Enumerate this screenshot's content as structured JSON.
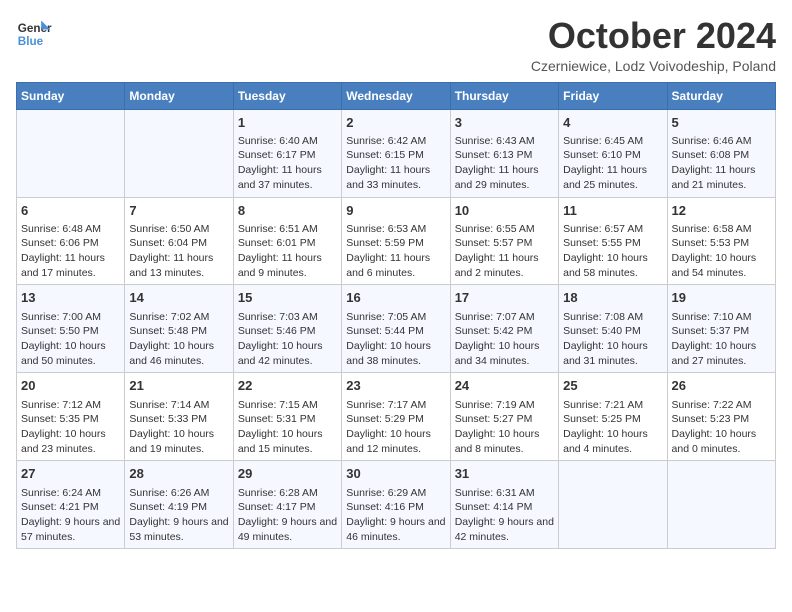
{
  "header": {
    "logo_line1": "General",
    "logo_line2": "Blue",
    "month_title": "October 2024",
    "location": "Czerniewice, Lodz Voivodeship, Poland"
  },
  "days_of_week": [
    "Sunday",
    "Monday",
    "Tuesday",
    "Wednesday",
    "Thursday",
    "Friday",
    "Saturday"
  ],
  "weeks": [
    [
      {
        "day": "",
        "info": ""
      },
      {
        "day": "",
        "info": ""
      },
      {
        "day": "1",
        "info": "Sunrise: 6:40 AM\nSunset: 6:17 PM\nDaylight: 11 hours and 37 minutes."
      },
      {
        "day": "2",
        "info": "Sunrise: 6:42 AM\nSunset: 6:15 PM\nDaylight: 11 hours and 33 minutes."
      },
      {
        "day": "3",
        "info": "Sunrise: 6:43 AM\nSunset: 6:13 PM\nDaylight: 11 hours and 29 minutes."
      },
      {
        "day": "4",
        "info": "Sunrise: 6:45 AM\nSunset: 6:10 PM\nDaylight: 11 hours and 25 minutes."
      },
      {
        "day": "5",
        "info": "Sunrise: 6:46 AM\nSunset: 6:08 PM\nDaylight: 11 hours and 21 minutes."
      }
    ],
    [
      {
        "day": "6",
        "info": "Sunrise: 6:48 AM\nSunset: 6:06 PM\nDaylight: 11 hours and 17 minutes."
      },
      {
        "day": "7",
        "info": "Sunrise: 6:50 AM\nSunset: 6:04 PM\nDaylight: 11 hours and 13 minutes."
      },
      {
        "day": "8",
        "info": "Sunrise: 6:51 AM\nSunset: 6:01 PM\nDaylight: 11 hours and 9 minutes."
      },
      {
        "day": "9",
        "info": "Sunrise: 6:53 AM\nSunset: 5:59 PM\nDaylight: 11 hours and 6 minutes."
      },
      {
        "day": "10",
        "info": "Sunrise: 6:55 AM\nSunset: 5:57 PM\nDaylight: 11 hours and 2 minutes."
      },
      {
        "day": "11",
        "info": "Sunrise: 6:57 AM\nSunset: 5:55 PM\nDaylight: 10 hours and 58 minutes."
      },
      {
        "day": "12",
        "info": "Sunrise: 6:58 AM\nSunset: 5:53 PM\nDaylight: 10 hours and 54 minutes."
      }
    ],
    [
      {
        "day": "13",
        "info": "Sunrise: 7:00 AM\nSunset: 5:50 PM\nDaylight: 10 hours and 50 minutes."
      },
      {
        "day": "14",
        "info": "Sunrise: 7:02 AM\nSunset: 5:48 PM\nDaylight: 10 hours and 46 minutes."
      },
      {
        "day": "15",
        "info": "Sunrise: 7:03 AM\nSunset: 5:46 PM\nDaylight: 10 hours and 42 minutes."
      },
      {
        "day": "16",
        "info": "Sunrise: 7:05 AM\nSunset: 5:44 PM\nDaylight: 10 hours and 38 minutes."
      },
      {
        "day": "17",
        "info": "Sunrise: 7:07 AM\nSunset: 5:42 PM\nDaylight: 10 hours and 34 minutes."
      },
      {
        "day": "18",
        "info": "Sunrise: 7:08 AM\nSunset: 5:40 PM\nDaylight: 10 hours and 31 minutes."
      },
      {
        "day": "19",
        "info": "Sunrise: 7:10 AM\nSunset: 5:37 PM\nDaylight: 10 hours and 27 minutes."
      }
    ],
    [
      {
        "day": "20",
        "info": "Sunrise: 7:12 AM\nSunset: 5:35 PM\nDaylight: 10 hours and 23 minutes."
      },
      {
        "day": "21",
        "info": "Sunrise: 7:14 AM\nSunset: 5:33 PM\nDaylight: 10 hours and 19 minutes."
      },
      {
        "day": "22",
        "info": "Sunrise: 7:15 AM\nSunset: 5:31 PM\nDaylight: 10 hours and 15 minutes."
      },
      {
        "day": "23",
        "info": "Sunrise: 7:17 AM\nSunset: 5:29 PM\nDaylight: 10 hours and 12 minutes."
      },
      {
        "day": "24",
        "info": "Sunrise: 7:19 AM\nSunset: 5:27 PM\nDaylight: 10 hours and 8 minutes."
      },
      {
        "day": "25",
        "info": "Sunrise: 7:21 AM\nSunset: 5:25 PM\nDaylight: 10 hours and 4 minutes."
      },
      {
        "day": "26",
        "info": "Sunrise: 7:22 AM\nSunset: 5:23 PM\nDaylight: 10 hours and 0 minutes."
      }
    ],
    [
      {
        "day": "27",
        "info": "Sunrise: 6:24 AM\nSunset: 4:21 PM\nDaylight: 9 hours and 57 minutes."
      },
      {
        "day": "28",
        "info": "Sunrise: 6:26 AM\nSunset: 4:19 PM\nDaylight: 9 hours and 53 minutes."
      },
      {
        "day": "29",
        "info": "Sunrise: 6:28 AM\nSunset: 4:17 PM\nDaylight: 9 hours and 49 minutes."
      },
      {
        "day": "30",
        "info": "Sunrise: 6:29 AM\nSunset: 4:16 PM\nDaylight: 9 hours and 46 minutes."
      },
      {
        "day": "31",
        "info": "Sunrise: 6:31 AM\nSunset: 4:14 PM\nDaylight: 9 hours and 42 minutes."
      },
      {
        "day": "",
        "info": ""
      },
      {
        "day": "",
        "info": ""
      }
    ]
  ]
}
